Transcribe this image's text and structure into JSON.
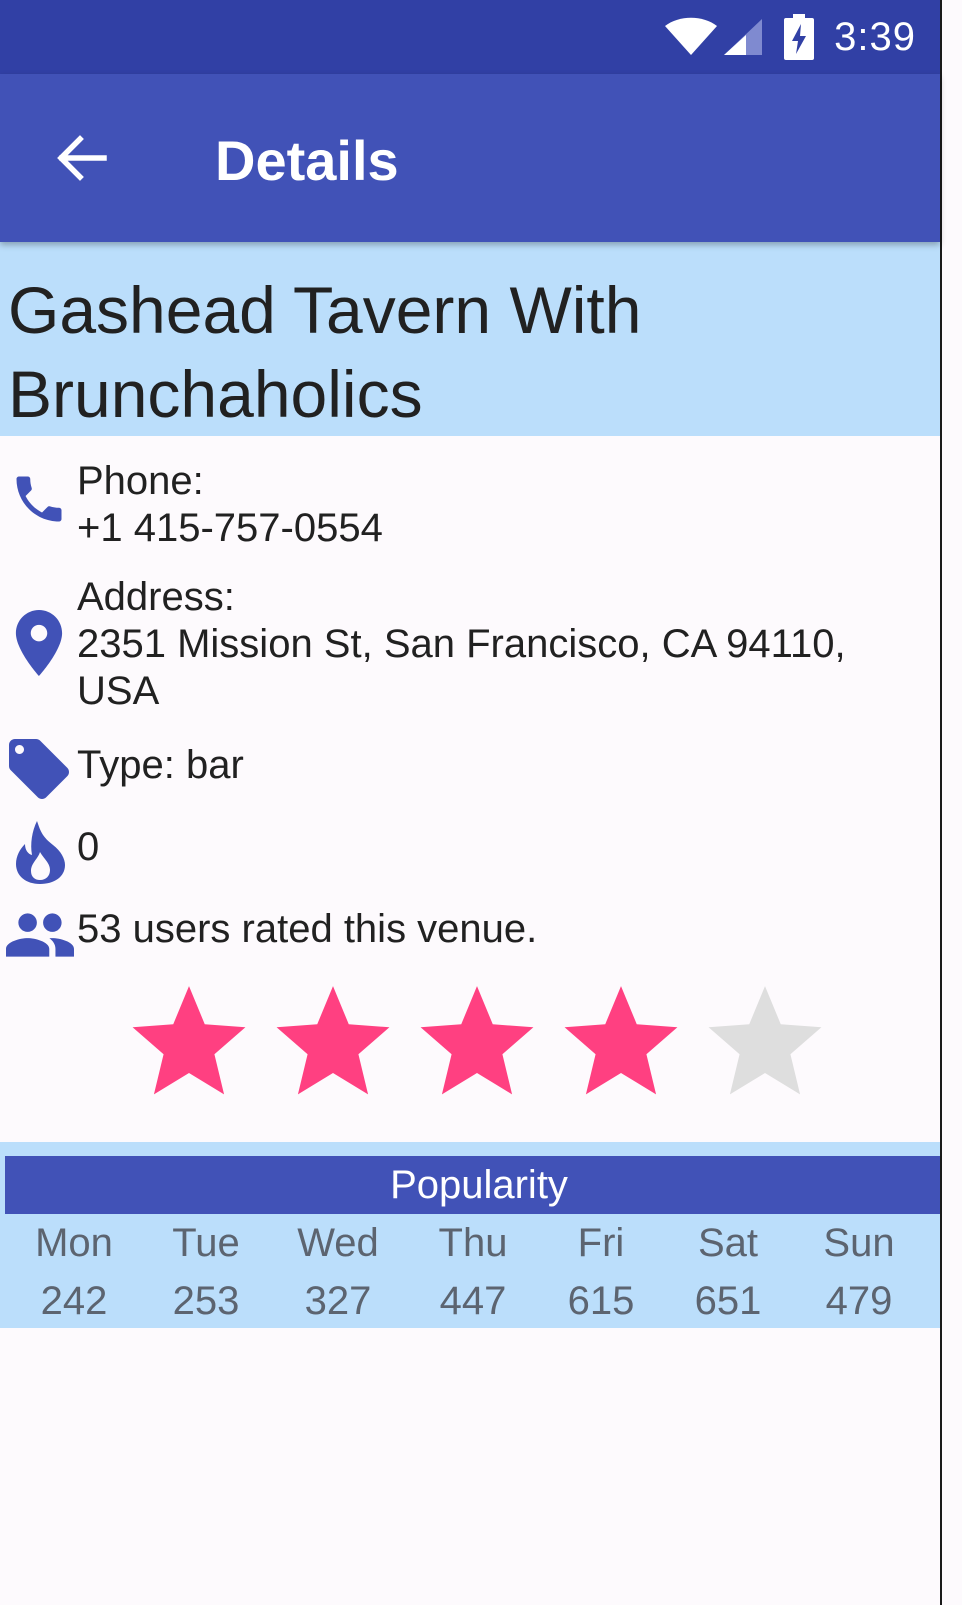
{
  "status_bar": {
    "time": "3:39",
    "icons": [
      "wifi-icon",
      "signal-icon",
      "battery-charging-icon"
    ]
  },
  "app_bar": {
    "title": "Details",
    "back_icon": "arrow-back-icon"
  },
  "venue": {
    "name": "Gashead Tavern With Brunchaholics",
    "phone_label": "Phone:",
    "phone": "+1 415-757-0554",
    "address_label": "Address:",
    "address": "2351 Mission St, San Francisco, CA 94110, USA",
    "type": "Type: bar",
    "hot_count": "0",
    "ratings_text": "53 users rated this venue.",
    "rating": {
      "filled": 4,
      "max": 5
    }
  },
  "popularity": {
    "title": "Popularity",
    "days": [
      {
        "day": "Mon",
        "value": "242"
      },
      {
        "day": "Tue",
        "value": "253"
      },
      {
        "day": "Wed",
        "value": "327"
      },
      {
        "day": "Thu",
        "value": "447"
      },
      {
        "day": "Fri",
        "value": "615"
      },
      {
        "day": "Sat",
        "value": "651"
      },
      {
        "day": "Sun",
        "value": "479"
      }
    ]
  },
  "colors": {
    "status_bar": "#3140a5",
    "app_bar": "#4152b7",
    "header_bg": "#bbdefb",
    "icon": "#4152b7",
    "star_filled": "#ff4081",
    "star_empty": "#dedede"
  }
}
